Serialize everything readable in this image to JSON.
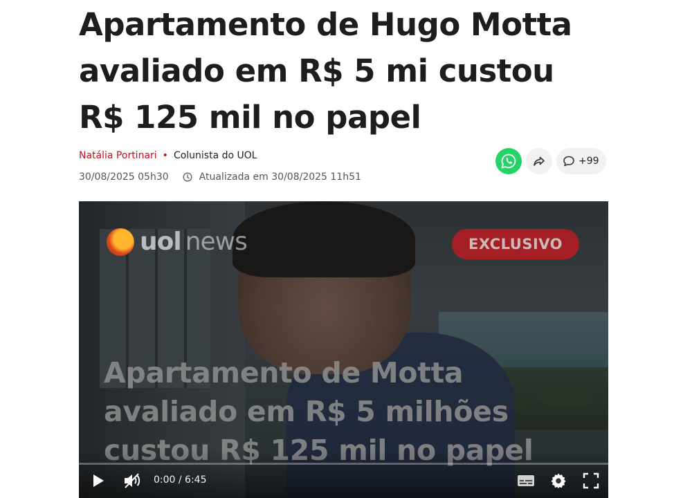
{
  "article": {
    "headline": "Apartamento de Hugo Motta avaliado em R$ 5 mi custou R$ 125 mil no papel",
    "author": "Natália Portinari",
    "separator": "•",
    "role": "Colunista do UOL",
    "published": "30/08/2025 05h30",
    "updated": "Atualizada em 30/08/2025 11h51"
  },
  "share": {
    "comments_count": "+99",
    "icons": [
      "whatsapp-icon",
      "share-icon",
      "comment-icon"
    ]
  },
  "video": {
    "brand_logo": "uol",
    "brand_word": "news",
    "badge": "EXCLUSIVO",
    "overlay_title": "Apartamento de Motta avaliado em R$ 5 milhões custou R$ 125 mil no papel",
    "time": "0:00 / 6:45",
    "progress": 0,
    "controls": [
      "play-icon",
      "volume-muted-icon",
      "captions-icon",
      "settings-icon",
      "fullscreen-icon"
    ]
  },
  "colors": {
    "author": "#c1121f",
    "whatsapp": "#25d366",
    "badge": "#b81c22"
  }
}
